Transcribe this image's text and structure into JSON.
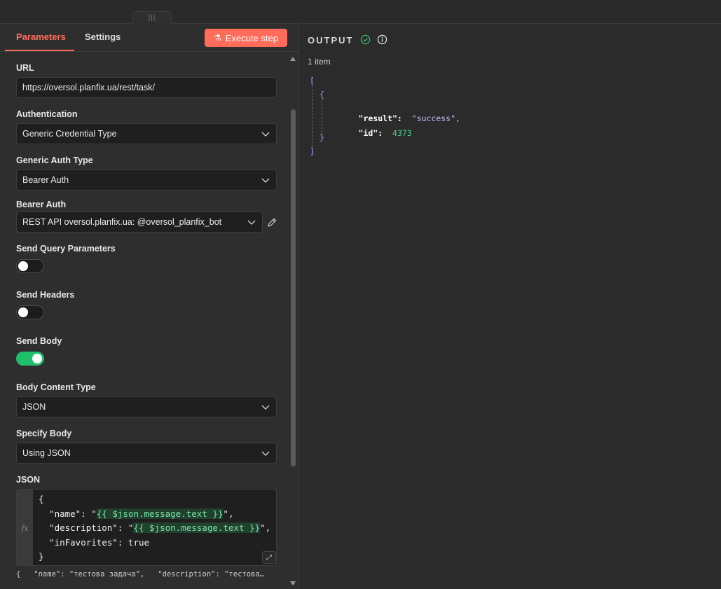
{
  "tabs": [
    {
      "label": "Parameters",
      "active": true
    },
    {
      "label": "Settings",
      "active": false
    }
  ],
  "execute_button": {
    "label": "Execute step",
    "icon": "flask-icon"
  },
  "fields": {
    "url": {
      "label": "URL",
      "value": "https://oversol.planfix.ua/rest/task/"
    },
    "authentication": {
      "label": "Authentication",
      "value": "Generic Credential Type"
    },
    "generic_auth_type": {
      "label": "Generic Auth Type",
      "value": "Bearer Auth"
    },
    "bearer_auth": {
      "label": "Bearer Auth",
      "value": "REST API oversol.planfix.ua: @oversol_planfix_bot"
    },
    "send_query": {
      "label": "Send Query Parameters",
      "enabled": false
    },
    "send_headers": {
      "label": "Send Headers",
      "enabled": false
    },
    "send_body": {
      "label": "Send Body",
      "enabled": true
    },
    "body_content_type": {
      "label": "Body Content Type",
      "value": "JSON"
    },
    "specify_body": {
      "label": "Specify Body",
      "value": "Using JSON"
    },
    "json": {
      "label": "JSON",
      "fx": "fx",
      "lines": {
        "l1": "{",
        "l2_key": "  \"name\": \"",
        "l2_expr": "{{ $json.message.text }}",
        "l2_end": "\",",
        "l3_key": "  \"description\": \"",
        "l3_expr": "{{ $json.message.text }}",
        "l3_end": "\",",
        "l4": "  \"inFavorites\": true",
        "l5": "}"
      },
      "preview": "{   \"name\": \"тестова задача\",   \"description\": \"тестова…"
    }
  },
  "output": {
    "title": "OUTPUT",
    "count": "1 item",
    "json": {
      "open_bracket": "[",
      "open_brace": "{",
      "result_key": "\"result\":",
      "result_value": "\"success\",",
      "id_key": "\"id\":",
      "id_value": "4373",
      "close_brace": "}",
      "close_bracket": "]"
    }
  },
  "colors": {
    "accent": "#ff6d5a",
    "toggle_on": "#1fbf6b",
    "background": "#2b2b2b"
  }
}
